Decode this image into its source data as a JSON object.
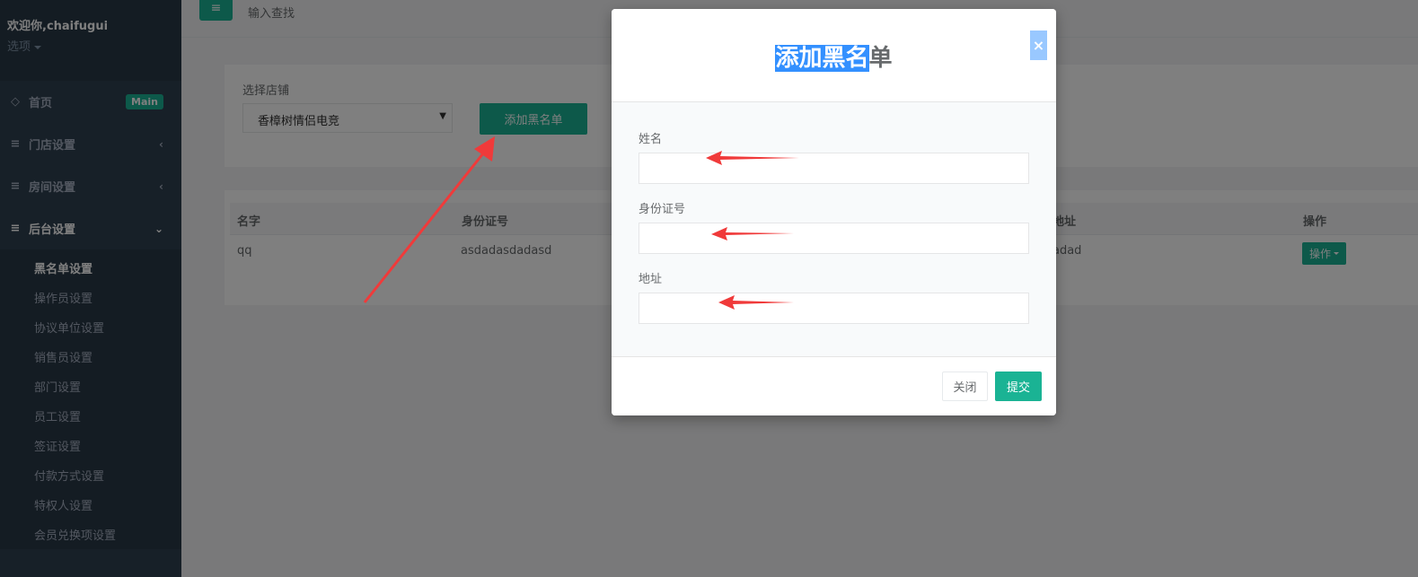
{
  "sidebar": {
    "welcome": "欢迎你,chaifugui",
    "options_label": "选项",
    "nav": [
      {
        "label": "首页",
        "badge": "Main"
      },
      {
        "label": "门店设置"
      },
      {
        "label": "房间设置"
      },
      {
        "label": "后台设置"
      }
    ],
    "sub_items": [
      {
        "label": "黑名单设置"
      },
      {
        "label": "操作员设置"
      },
      {
        "label": "协议单位设置"
      },
      {
        "label": "销售员设置"
      },
      {
        "label": "部门设置"
      },
      {
        "label": "员工设置"
      },
      {
        "label": "签证设置"
      },
      {
        "label": "付款方式设置"
      },
      {
        "label": "特权人设置"
      },
      {
        "label": "会员兑换项设置"
      }
    ]
  },
  "topbar": {
    "search_text": "输入查找"
  },
  "filter": {
    "store_label": "选择店铺",
    "store_value": "香樟树情侣电竞",
    "add_button": "添加黑名单"
  },
  "table": {
    "headers": [
      "名字",
      "身份证号",
      "地址",
      "操作"
    ],
    "rows": [
      {
        "name": "qq",
        "id_number": "asdadasdadasd",
        "address": "adad",
        "action": "操作"
      }
    ]
  },
  "modal": {
    "title_highlighted": "添加黑名",
    "title_rest": "单",
    "close_symbol": "×",
    "fields": [
      {
        "label": "姓名",
        "value": ""
      },
      {
        "label": "身份证号",
        "value": ""
      },
      {
        "label": "地址",
        "value": ""
      }
    ],
    "close_button": "关闭",
    "submit_button": "提交"
  },
  "colors": {
    "primary": "#1ab394",
    "sidebar": "#2f4050",
    "annotation_arrow": "#f03a3a"
  }
}
